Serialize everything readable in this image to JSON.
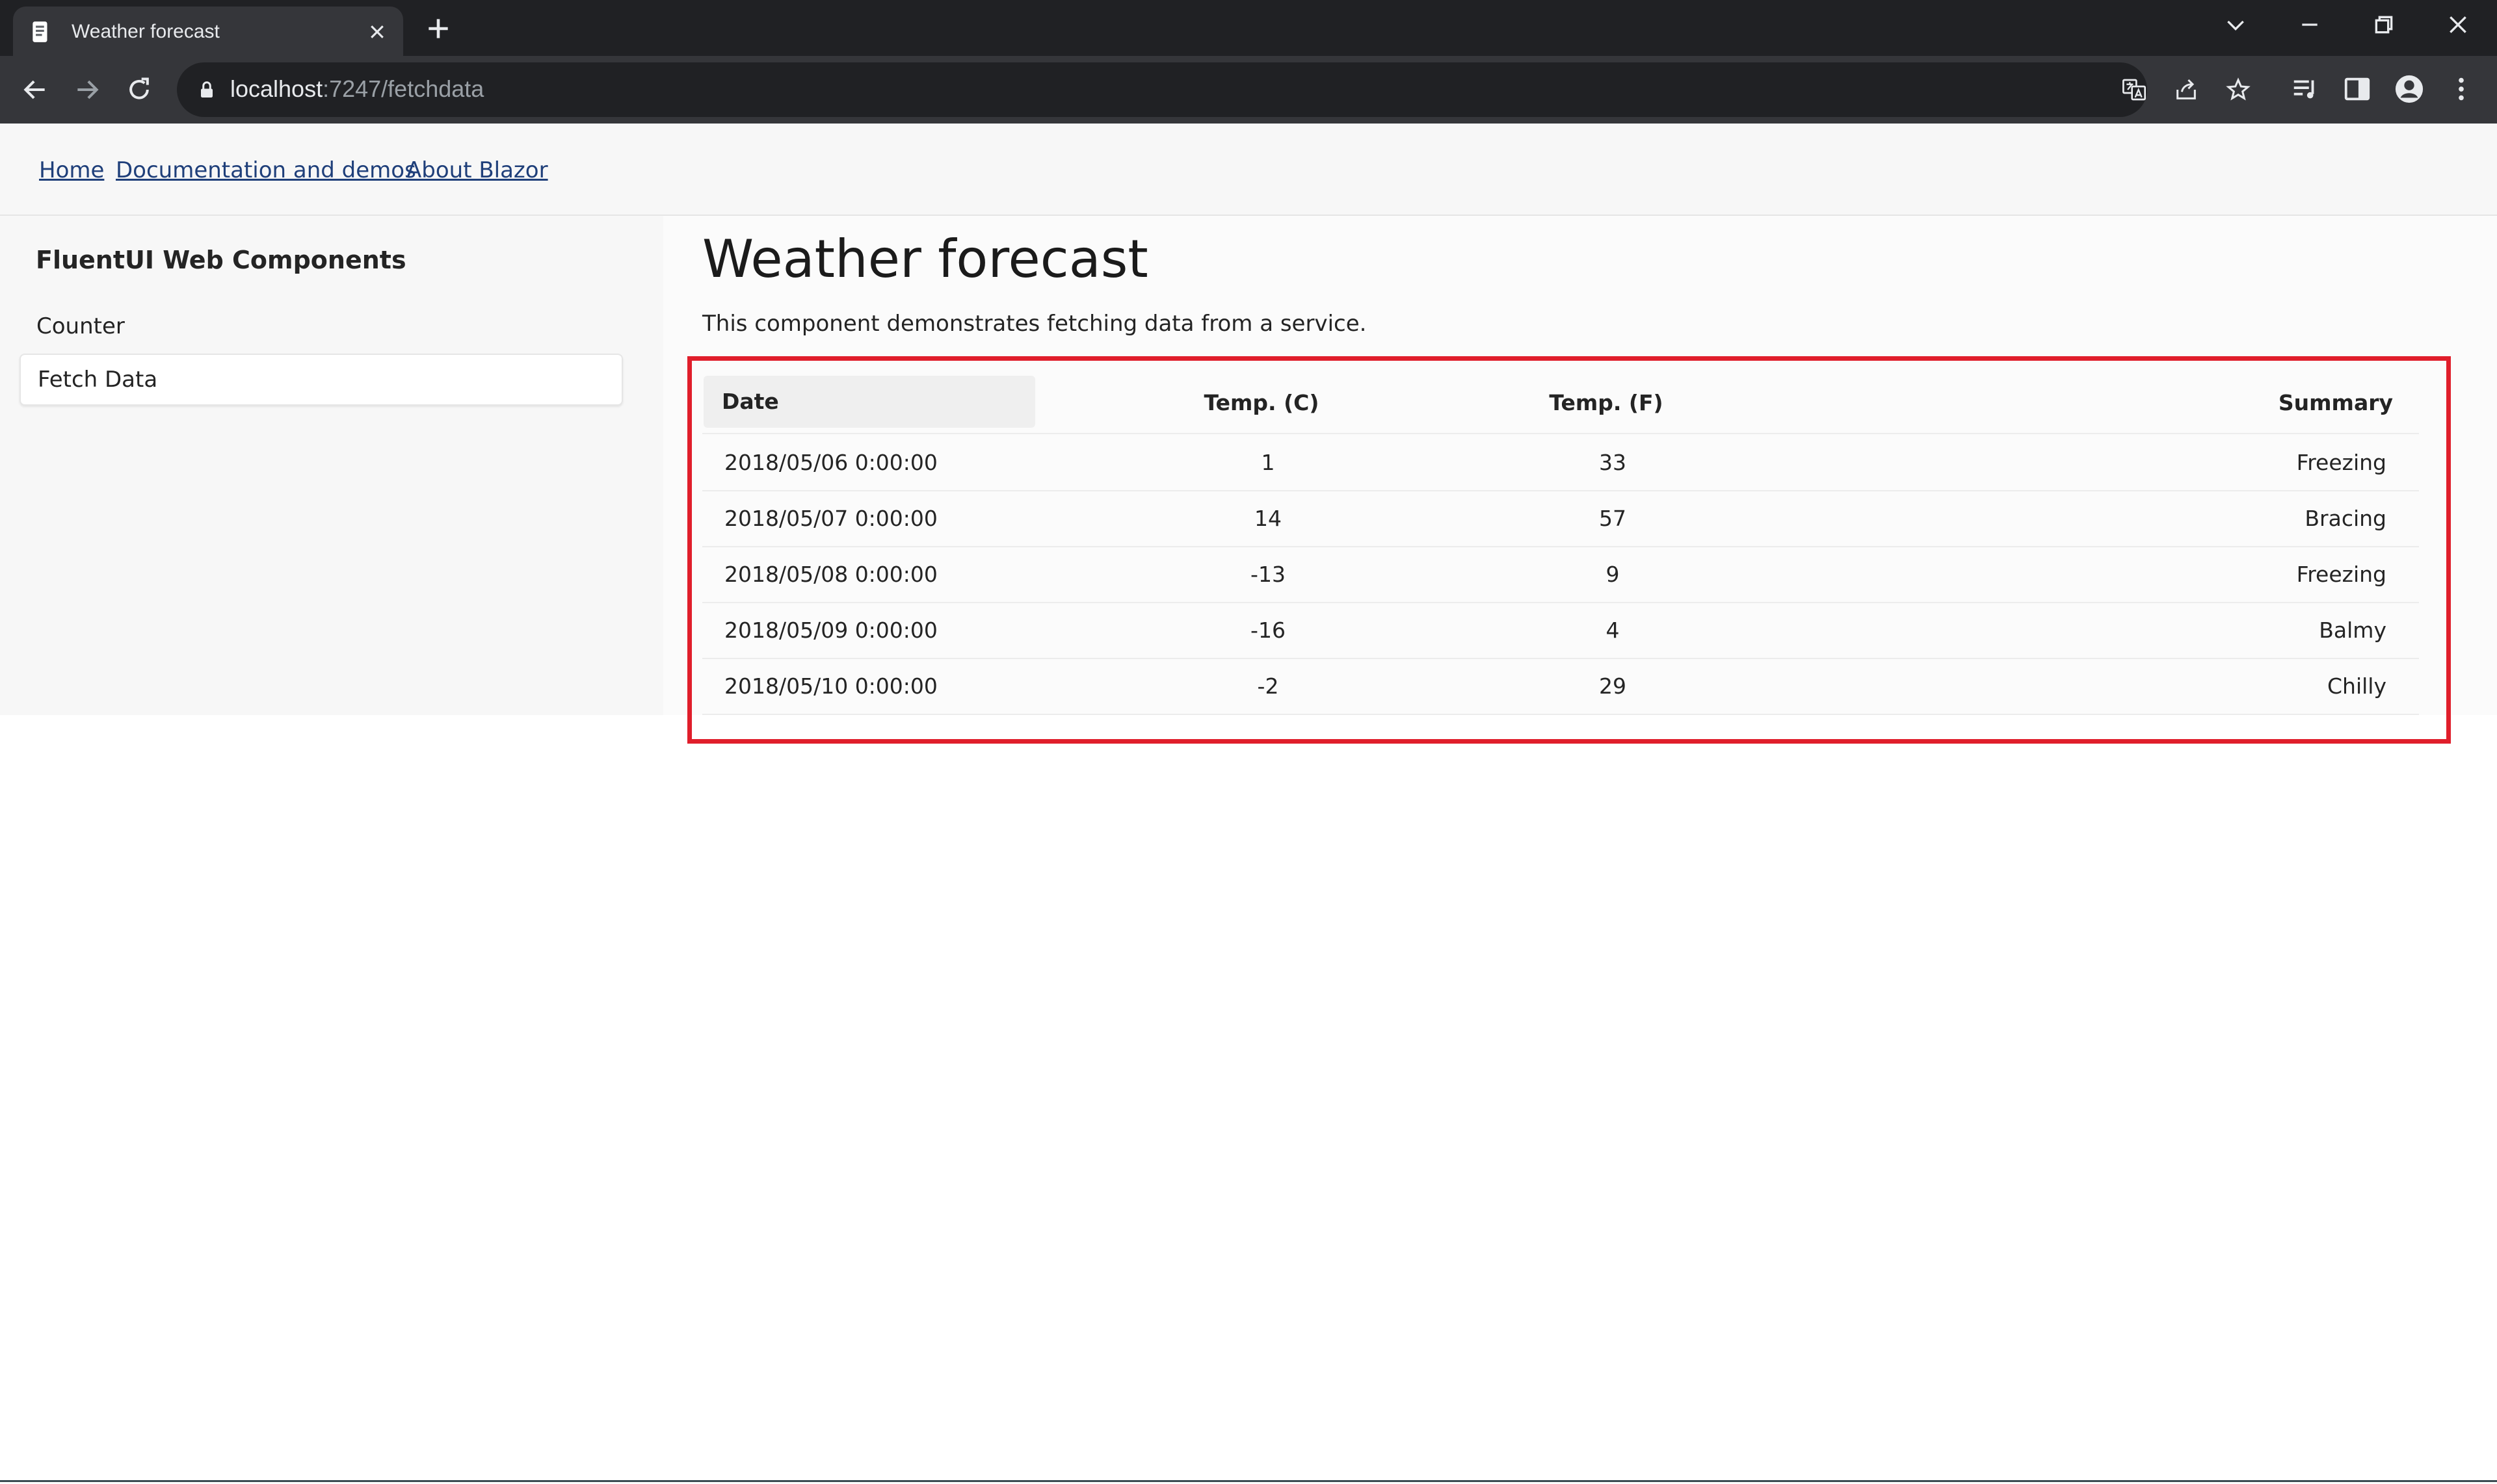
{
  "browser": {
    "tab_title": "Weather forecast",
    "url_host": "localhost",
    "url_path": ":7247/fetchdata"
  },
  "topnav": {
    "links": [
      "Home",
      "Documentation and demos",
      "About Blazor"
    ]
  },
  "sidebar": {
    "title": "FluentUI Web Components",
    "items": [
      {
        "label": "Counter",
        "active": false
      },
      {
        "label": "Fetch Data",
        "active": true
      }
    ]
  },
  "main": {
    "title": "Weather forecast",
    "description": "This component demonstrates fetching data from a service."
  },
  "grid": {
    "headers": {
      "date": "Date",
      "temp_c": "Temp. (C)",
      "temp_f": "Temp. (F)",
      "summary": "Summary"
    },
    "rows": [
      {
        "date": "2018/05/06 0:00:00",
        "temp_c": "1",
        "temp_f": "33",
        "summary": "Freezing"
      },
      {
        "date": "2018/05/07 0:00:00",
        "temp_c": "14",
        "temp_f": "57",
        "summary": "Bracing"
      },
      {
        "date": "2018/05/08 0:00:00",
        "temp_c": "-13",
        "temp_f": "9",
        "summary": "Freezing"
      },
      {
        "date": "2018/05/09 0:00:00",
        "temp_c": "-16",
        "temp_f": "4",
        "summary": "Balmy"
      },
      {
        "date": "2018/05/10 0:00:00",
        "temp_c": "-2",
        "temp_f": "29",
        "summary": "Chilly"
      }
    ]
  },
  "colors": {
    "highlight_border": "#e01e2b",
    "link": "#1f3f7a",
    "chrome_dark": "#202124",
    "chrome_toolbar": "#35363a"
  },
  "icons": {
    "tab_favicon": "document-icon",
    "back": "back-arrow-icon",
    "forward": "forward-arrow-icon",
    "reload": "reload-icon",
    "lock": "lock-icon",
    "translate": "translate-icon",
    "share": "share-icon",
    "bookmark": "star-icon",
    "media": "media-list-icon",
    "side_panel": "side-panel-icon",
    "profile": "profile-icon",
    "menu": "kebab-menu-icon"
  }
}
